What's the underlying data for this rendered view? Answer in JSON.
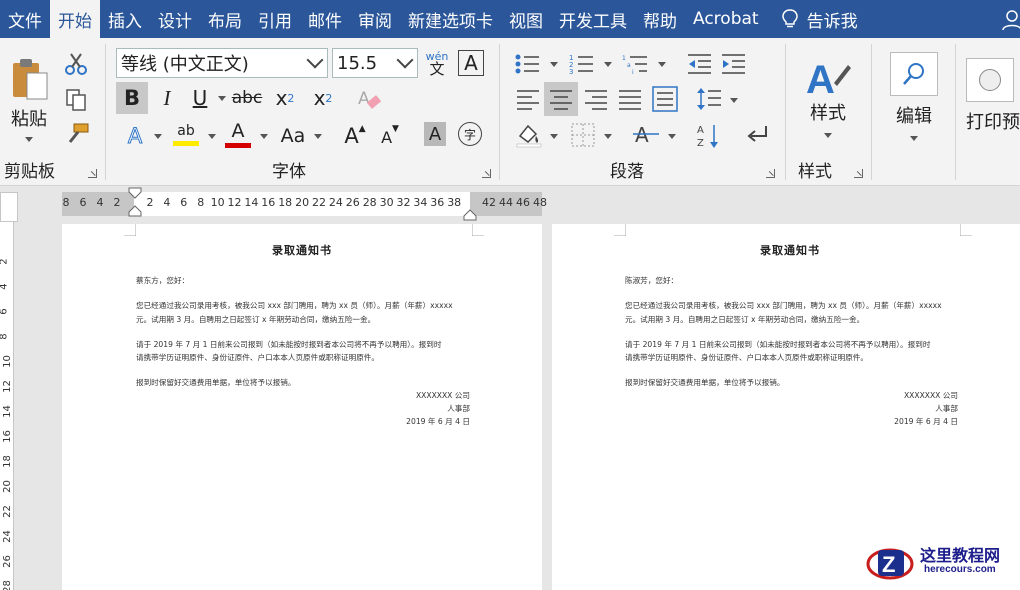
{
  "tabs": [
    "文件",
    "开始",
    "插入",
    "设计",
    "布局",
    "引用",
    "邮件",
    "审阅",
    "新建选项卡",
    "视图",
    "开发工具",
    "帮助",
    "Acrobat",
    "告诉我"
  ],
  "active_tab": "开始",
  "ribbon": {
    "clipboard": {
      "label": "剪贴板",
      "paste_label": "粘贴"
    },
    "font": {
      "label": "字体",
      "font_name": "等线 (中文正文)",
      "font_size": "15.5",
      "phonetic_top": "wén",
      "phonetic_bottom": "文",
      "bold": "B",
      "italic": "I",
      "underline": "U",
      "strike": "abc",
      "subscript_base": "x",
      "subscript": "2",
      "superscript_base": "x",
      "superscript": "2",
      "text_effect": "A",
      "highlight_text": "ab",
      "font_color": "A",
      "change_case": "Aa",
      "grow": "A",
      "shrink": "A",
      "shading": "A",
      "enclose": "字"
    },
    "paragraph": {
      "label": "段落"
    },
    "styles": {
      "label": "样式",
      "button_label": "样式"
    },
    "editing": {
      "button_label": "编辑"
    },
    "print": {
      "button_label": "打印预"
    }
  },
  "ruler": {
    "left_numbers": [
      "8",
      "6",
      "4",
      "2"
    ],
    "right_numbers": [
      "2",
      "4",
      "6",
      "8",
      "10",
      "12",
      "14",
      "16",
      "18",
      "20",
      "22",
      "24",
      "26",
      "28",
      "30",
      "32",
      "34",
      "36",
      "38"
    ],
    "gray_numbers": [
      "42",
      "44",
      "46",
      "48"
    ],
    "vertical_numbers": [
      "2",
      "4",
      "6",
      "8",
      "10",
      "12",
      "14",
      "16",
      "18",
      "20",
      "22",
      "24",
      "26",
      "28"
    ]
  },
  "pages": [
    {
      "title": "录取通知书",
      "greeting": "蔡东方，您好：",
      "p1_line1": "您已经通过我公司录用考核，被我公司 xxx 部门聘用，聘为 xx 员（师）。月薪（年薪）xxxxx",
      "p1_line2": "元。试用期 3 月。自聘用之日起签订 x 年期劳动合同，缴纳五险一金。",
      "p2_line1": "请于 2019 年 7 月 1 日前来公司报到（如未能按时报到者本公司将不再予以聘用）。报到时",
      "p2_line2": "请携带学历证明原件、身份证原件、户口本本人页原件或职称证明原件。",
      "p3": "报到时保留好交通费用单据，单位将予以报销。",
      "company": "XXXXXXX 公司",
      "dept": "人事部",
      "date": "2019 年 6 月 4 日"
    },
    {
      "title": "录取通知书",
      "greeting": "陈淑芳，您好：",
      "p1_line1": "您已经通过我公司录用考核，被我公司 xxx 部门聘用，聘为 xx 员（师）。月薪（年薪）xxxxx",
      "p1_line2": "元。试用期 3 月。自聘用之日起签订 x 年期劳动合同，缴纳五险一金。",
      "p2_line1": "请于 2019 年 7 月 1 日前来公司报到（如未能按时报到者本公司将不再予以聘用）。报到时",
      "p2_line2": "请携带学历证明原件、身份证原件、户口本本人页原件或职称证明原件。",
      "p3": "报到时保留好交通费用单据，单位将予以报销。",
      "company": "XXXXXXX 公司",
      "dept": "人事部",
      "date": "2019 年 6 月 4 日"
    }
  ],
  "watermark": {
    "title": "这里教程网",
    "url": "herecours.com"
  },
  "colors": {
    "tab_bar": "#2b579a",
    "ribbon": "#f3f3f3",
    "highlight_yellow": "#ffeb00",
    "font_red": "#d40000",
    "text_blue": "#2f74c5"
  }
}
